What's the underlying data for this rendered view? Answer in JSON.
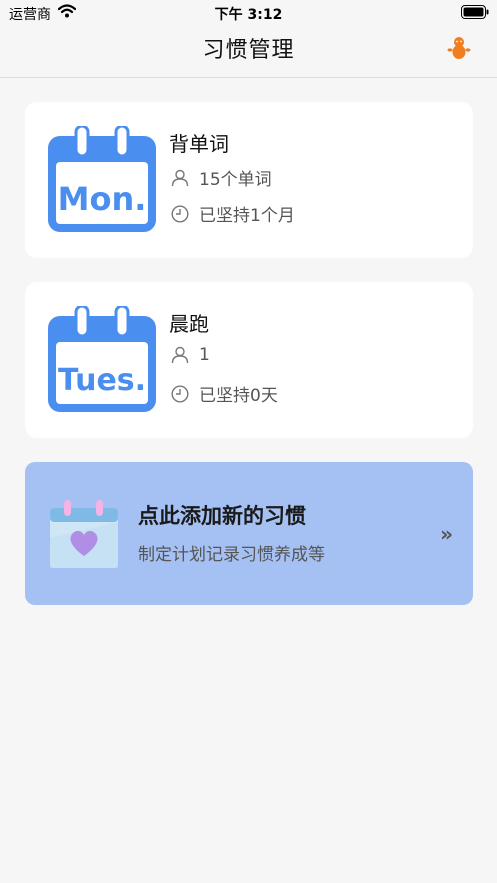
{
  "status_bar": {
    "carrier": "运营商",
    "time": "下午 3:12"
  },
  "nav": {
    "title": "习惯管理",
    "profile_icon": "person-icon"
  },
  "habits": [
    {
      "calendar_label": "Mon.",
      "name": "背单词",
      "count_text": "15个单词",
      "streak_text": "已坚持1个月"
    },
    {
      "calendar_label": "Tues.",
      "name": "晨跑",
      "count_text": "1",
      "streak_text": "已坚持0天"
    }
  ],
  "add_banner": {
    "headline": "点此添加新的习惯",
    "subtitle": "制定计划记录习惯养成等",
    "chevron": "»"
  },
  "colors": {
    "calendar_blue": "#4a8ef0",
    "banner_bg": "#a5c0f2",
    "profile_orange": "#f07d1e"
  }
}
